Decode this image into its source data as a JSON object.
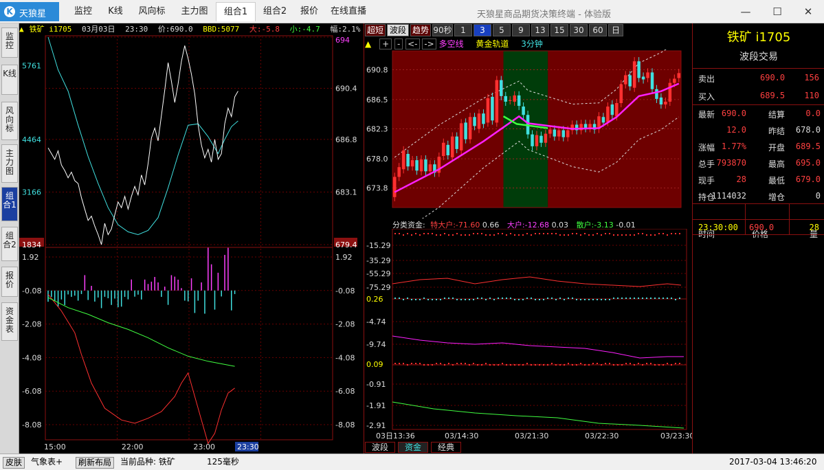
{
  "app": {
    "logo": "天狼星",
    "window_title": "天狼星商品期货决策终端 - 体验版"
  },
  "nav": [
    "监控",
    "K线",
    "风向标",
    "主力图",
    "组合1",
    "组合2",
    "报价",
    "在线直播"
  ],
  "window_buttons": {
    "minimize": "—",
    "maximize": "☐",
    "close": "✕"
  },
  "left_tabs": [
    "监控",
    "K线",
    "风向标",
    "主力图",
    "组合1",
    "组合2",
    "报价",
    "资金表"
  ],
  "infobar": {
    "name": "铁矿 i1705",
    "date": "03月03日",
    "time": "23:30",
    "price": "价:690.0",
    "bbd": "BBD:5077",
    "big": "大:-5.8",
    "small": "小:-4.7",
    "range": "幅:2.1%"
  },
  "intraday": {
    "left_axis": [
      "5761",
      "4464",
      "3166",
      "1834"
    ],
    "right_axis": [
      "694",
      "690.4",
      "686.8",
      "683.1",
      "679.4"
    ],
    "price_line": [
      [
        0,
        686.2
      ],
      [
        2,
        685.4
      ],
      [
        3,
        686.0
      ],
      [
        4,
        685.0
      ],
      [
        5,
        684.6
      ],
      [
        6,
        684.1
      ],
      [
        7,
        684.5
      ],
      [
        8,
        683.9
      ],
      [
        9,
        683.7
      ],
      [
        10,
        682.7
      ],
      [
        11,
        681.9
      ],
      [
        12,
        681.1
      ],
      [
        13,
        681.4
      ],
      [
        14,
        680.7
      ],
      [
        15,
        680.1
      ],
      [
        16,
        679.4
      ],
      [
        17,
        680.9
      ],
      [
        18,
        680.1
      ],
      [
        19,
        680.5
      ],
      [
        20,
        681.5
      ],
      [
        21,
        682.4
      ],
      [
        22,
        682.0
      ],
      [
        23,
        682.8
      ],
      [
        24,
        681.9
      ],
      [
        25,
        682.8
      ],
      [
        26,
        683.5
      ],
      [
        27,
        682.9
      ],
      [
        28,
        684.3
      ],
      [
        29,
        683.6
      ],
      [
        30,
        685.1
      ],
      [
        31,
        686.9
      ],
      [
        32,
        687.6
      ],
      [
        33,
        686.7
      ],
      [
        34,
        688.5
      ],
      [
        35,
        690.3
      ],
      [
        36,
        692.2
      ],
      [
        37,
        690.9
      ],
      [
        38,
        689.4
      ],
      [
        39,
        690.7
      ],
      [
        40,
        692.3
      ],
      [
        41,
        693.4
      ],
      [
        42,
        692.5
      ],
      [
        43,
        691.4
      ],
      [
        44,
        690.0
      ],
      [
        45,
        687.8
      ],
      [
        46,
        686.4
      ],
      [
        47,
        685.5
      ],
      [
        48,
        686.1
      ],
      [
        49,
        685.2
      ],
      [
        50,
        686.8
      ],
      [
        51,
        685.4
      ],
      [
        52,
        685.8
      ],
      [
        53,
        687.9
      ],
      [
        54,
        689.0
      ],
      [
        55,
        688.4
      ],
      [
        56,
        689.8
      ],
      [
        57,
        690.2
      ]
    ],
    "avg_line": [
      [
        0,
        694.0
      ],
      [
        3,
        691.7
      ],
      [
        6,
        690.2
      ],
      [
        9,
        687.8
      ],
      [
        12,
        685.6
      ],
      [
        15,
        683.7
      ],
      [
        18,
        682.0
      ],
      [
        21,
        680.8
      ],
      [
        24,
        680.3
      ],
      [
        27,
        680.1
      ],
      [
        30,
        680.4
      ],
      [
        33,
        681.3
      ],
      [
        36,
        683.4
      ],
      [
        39,
        685.7
      ],
      [
        42,
        687.8
      ],
      [
        45,
        687.9
      ],
      [
        48,
        687.0
      ],
      [
        51,
        685.8
      ],
      [
        53,
        686.8
      ],
      [
        55,
        687.7
      ],
      [
        57,
        688.1
      ]
    ],
    "xlabels": [
      "15:00",
      "22:00",
      "23:00"
    ],
    "time_badge": "23:30",
    "lower_axis": [
      "1.92",
      "-0.08",
      "-2.08",
      "-4.08",
      "-6.08",
      "-8.08"
    ]
  },
  "kline": {
    "period_buttons": [
      "超短",
      "波段",
      "趋势",
      "90秒",
      "1",
      "3",
      "5",
      "9",
      "13",
      "15",
      "30",
      "60",
      "日"
    ],
    "active_period": "3",
    "toolbar": {
      "up": "▲",
      "plus": "+",
      "minus": "-",
      "left": "<-",
      "right": "->",
      "duokong": "多空线",
      "gold": "黄金轨道",
      "period": "3分钟"
    },
    "yaxis": [
      "690.8",
      "686.5",
      "682.3",
      "678.0",
      "673.8"
    ],
    "candles": [
      [
        672.5,
        675.4
      ],
      [
        675.4,
        676.8
      ],
      [
        676.5,
        679.2
      ],
      [
        678.7,
        676.9
      ],
      [
        676.9,
        677.8
      ],
      [
        677.8,
        676.3
      ],
      [
        676.2,
        677.9
      ],
      [
        677.9,
        676.2
      ],
      [
        676.2,
        677.2
      ],
      [
        677.2,
        676.0
      ],
      [
        676.0,
        678.3
      ],
      [
        678.4,
        680.3
      ],
      [
        680.0,
        678.5
      ],
      [
        678.2,
        681.2
      ],
      [
        681.2,
        679.4
      ],
      [
        679.2,
        683.1
      ],
      [
        683.2,
        680.8
      ],
      [
        680.8,
        684.0
      ],
      [
        684.0,
        682.7
      ],
      [
        682.3,
        684.5
      ],
      [
        684.5,
        683.0
      ],
      [
        683.2,
        686.7
      ],
      [
        686.9,
        683.5
      ],
      [
        683.2,
        689.3
      ],
      [
        689.3,
        687.0
      ],
      [
        687.0,
        686.2
      ],
      [
        686.4,
        686.4
      ],
      [
        686.2,
        687.1
      ],
      [
        687.1,
        685.6
      ],
      [
        685.5,
        684.3
      ],
      [
        684.3,
        681.5
      ],
      [
        681.5,
        679.8
      ],
      [
        679.8,
        681.4
      ],
      [
        681.3,
        680.3
      ],
      [
        680.3,
        681.6
      ],
      [
        681.6,
        682.2
      ],
      [
        682.2,
        681.2
      ],
      [
        681.2,
        682.1
      ],
      [
        682.1,
        681.1
      ],
      [
        681.1,
        682.1
      ],
      [
        682.1,
        682.9
      ],
      [
        682.9,
        682.1
      ],
      [
        682.1,
        683.0
      ],
      [
        683.0,
        682.4
      ],
      [
        682.4,
        683.0
      ],
      [
        683.0,
        682.2
      ],
      [
        682.3,
        684.1
      ],
      [
        684.0,
        683.2
      ],
      [
        683.3,
        685.5
      ],
      [
        685.8,
        684.3
      ],
      [
        684.1,
        686.0
      ],
      [
        686.0,
        688.7
      ],
      [
        688.7,
        690.0
      ],
      [
        690.0,
        688.4
      ],
      [
        688.2,
        692.0
      ],
      [
        692.0,
        689.6
      ],
      [
        689.8,
        689.4
      ],
      [
        689.6,
        690.4
      ],
      [
        690.4,
        688.0
      ],
      [
        688.0,
        686.6
      ],
      [
        686.8,
        685.8
      ],
      [
        685.8,
        686.2
      ],
      [
        686.2,
        688.9
      ],
      [
        688.9,
        689.5
      ],
      [
        689.6,
        690.3
      ]
    ],
    "ma": [
      [
        0,
        673.2
      ],
      [
        10,
        676.5
      ],
      [
        20,
        680.5
      ],
      [
        28,
        684.1
      ],
      [
        30,
        683.1
      ],
      [
        40,
        682.3
      ],
      [
        46,
        682.4
      ],
      [
        50,
        684.0
      ],
      [
        55,
        687.0
      ],
      [
        60,
        687.7
      ],
      [
        64,
        688.8
      ]
    ],
    "shade": [
      {
        "from": 0,
        "to": 25,
        "color": "#6e0000"
      },
      {
        "from": 25,
        "to": 35,
        "color": "#003c0a"
      },
      {
        "from": 35,
        "to": 65,
        "color": "#6e0000"
      }
    ]
  },
  "fund": {
    "legend": {
      "label": "分类资金:",
      "t_big": "特大户:-71.60",
      "t_big_v": "0.66",
      "big": "大户:-12.68",
      "big_v": "0.03",
      "small": "散户:-3.13",
      "small_v": "-0.01"
    },
    "yaxis": [
      "-15.29",
      "-35.29",
      "-55.29",
      "-75.29",
      "0.26",
      "-4.74",
      "-9.74",
      "0.09",
      "-0.91",
      "-1.91",
      "-2.91"
    ],
    "xlabels": [
      "03日13:36",
      "03/14:30",
      "03/21:30",
      "03/22:30",
      "03/23:30"
    ],
    "tabs": [
      "波段",
      "资金",
      "经典"
    ],
    "active_tab": "资金"
  },
  "quote": {
    "title": "铁矿 i1705",
    "subtitle": "波段交易",
    "sell": {
      "label": "卖出",
      "price": "690.0",
      "vol": "156"
    },
    "buy": {
      "label": "买入",
      "price": "689.5",
      "vol": "110"
    },
    "rows": [
      {
        "l1": "最新",
        "v1": "690.0",
        "l2": "结算",
        "v2": "0.0"
      },
      {
        "l1": "",
        "v1": "12.0",
        "l2": "昨结",
        "v2": "678.0"
      },
      {
        "l1": "涨幅",
        "v1": "1.77%",
        "l2": "开盘",
        "v2": "689.5"
      },
      {
        "l1": "总手",
        "v1": "793870",
        "l2": "最高",
        "v2": "695.0"
      },
      {
        "l1": "现手",
        "v1": "28",
        "l2": "最低",
        "v2": "679.0"
      },
      {
        "l1": "持仓",
        "v1": "1114032",
        "l2": "增仓",
        "v2": "0"
      }
    ],
    "ticks_header": [
      "时间",
      "价格",
      "量"
    ],
    "ticks": [
      {
        "time": "23:30:00",
        "price": "690.0",
        "vol": "28"
      }
    ]
  },
  "statusbar": {
    "skin": "皮肤",
    "weather": "气象表+",
    "refresh": "刷新布局",
    "current": "当前品种: 铁矿",
    "latency": "125毫秒",
    "datetime": "2017-03-04 13:46:20"
  },
  "colors": {
    "up": "#ff3030",
    "down": "#40e0e0",
    "accent": "#ffff00",
    "ma": "#ff20ff",
    "frame": "#8b1010"
  }
}
